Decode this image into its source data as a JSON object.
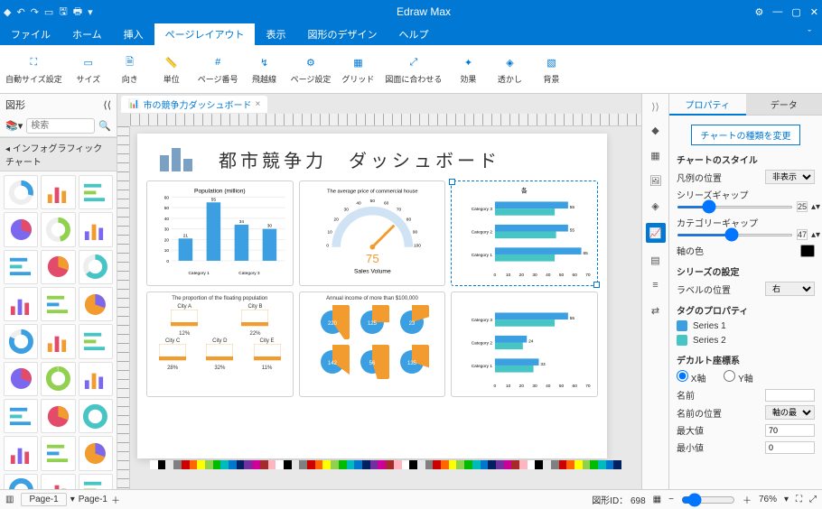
{
  "app": {
    "title": "Edraw Max"
  },
  "menu": {
    "items": [
      "ファイル",
      "ホーム",
      "挿入",
      "ページレイアウト",
      "表示",
      "図形のデザイン",
      "ヘルプ"
    ],
    "active": 3
  },
  "ribbon": [
    {
      "label": "自動サイズ設定"
    },
    {
      "label": "サイズ"
    },
    {
      "label": "向き"
    },
    {
      "label": "単位"
    },
    {
      "label": "ページ番号"
    },
    {
      "label": "飛越線"
    },
    {
      "label": "ページ設定"
    },
    {
      "label": "グリッド"
    },
    {
      "label": "図面に合わせる"
    },
    {
      "label": "効果"
    },
    {
      "label": "透かし"
    },
    {
      "label": "背景"
    }
  ],
  "leftpanel": {
    "title": "図形",
    "search_placeholder": "検索",
    "category": "インフォグラフィックチャート"
  },
  "doctab": {
    "name": "市の競争力ダッシュボード"
  },
  "dashboard": {
    "title": "都市競争力　ダッシュボード"
  },
  "rightpanel": {
    "tabs": [
      "プロパティ",
      "データ"
    ],
    "change_type": "チャートの種類を変更",
    "style_title": "チャートのスタイル",
    "legend_pos_label": "凡例の位置",
    "legend_pos_value": "非表示",
    "series_gap_label": "シリーズギャップ",
    "series_gap_value": "25",
    "category_gap_label": "カテゴリーギャップ",
    "category_gap_value": "47",
    "axis_color_label": "軸の色",
    "series_settings_title": "シリーズの設定",
    "label_pos_label": "ラベルの位置",
    "label_pos_value": "右",
    "tag_prop_title": "タグのプロパティ",
    "series1": "Series 1",
    "series2": "Series 2",
    "cartesian_title": "デカルト座標系",
    "xaxis": "X軸",
    "yaxis": "Y軸",
    "name_label": "名前",
    "name_pos_label": "名前の位置",
    "name_pos_value": "軸の最後",
    "max_label": "最大値",
    "max_value": "70",
    "min_label": "最小値",
    "min_value": "0"
  },
  "statusbar": {
    "page_label": "Page-1",
    "shape_id_label": "図形ID：",
    "shape_id": "698",
    "zoom": "76%"
  },
  "chart_data": [
    {
      "type": "bar",
      "title": "Population (million)",
      "categories": [
        "Category 1",
        "",
        "Category 3",
        ""
      ],
      "values": [
        21,
        55,
        34,
        30
      ],
      "ylim": [
        0,
        60
      ],
      "yticks": [
        0,
        10,
        20,
        30,
        40,
        50,
        60
      ],
      "color": "#3b9fe2"
    },
    {
      "type": "gauge",
      "title": "The average price of commercial house",
      "range": [
        0,
        100
      ],
      "ticks": [
        0,
        10,
        20,
        30,
        40,
        50,
        60,
        70,
        80,
        90,
        100
      ],
      "value": 75,
      "value_label": "75",
      "subtitle": "Sales Volume"
    },
    {
      "type": "bar",
      "title": "各",
      "orientation": "horizontal",
      "categories": [
        "Category 1",
        "Category 2",
        "Category 3"
      ],
      "series": [
        {
          "name": "Series 1",
          "values": [
            65,
            55,
            55
          ],
          "color": "#3b9fe2"
        },
        {
          "name": "Series 2",
          "values": [
            45,
            46,
            45
          ],
          "color": "#47c4c4"
        }
      ],
      "xlim": [
        0,
        70
      ],
      "xticks": [
        0,
        10,
        20,
        30,
        40,
        50,
        60,
        70
      ]
    },
    {
      "type": "table",
      "title": "The proportion of the floating population",
      "cells": [
        {
          "label": "City A",
          "value": "12%"
        },
        {
          "label": "City B",
          "value": "22%"
        },
        {
          "label": "City C",
          "value": "28%"
        },
        {
          "label": "City D",
          "value": "32%"
        },
        {
          "label": "City E",
          "value": "11%"
        }
      ]
    },
    {
      "type": "pie",
      "title": "Annual income of more than $100,000",
      "items": [
        {
          "label": "220",
          "a": 40,
          "b": 60
        },
        {
          "label": "125",
          "a": 25,
          "b": 75
        },
        {
          "label": "23",
          "a": 20,
          "b": 80
        },
        {
          "label": "142",
          "a": 35,
          "b": 65
        },
        {
          "label": "56",
          "a": 45,
          "b": 55
        },
        {
          "label": "135",
          "a": 30,
          "b": 70
        }
      ],
      "colors": [
        "#3b9fe2",
        "#f29b2e"
      ]
    },
    {
      "type": "bar",
      "orientation": "horizontal",
      "categories": [
        "Category 1",
        "Category 2",
        "Category 3"
      ],
      "series": [
        {
          "name": "Series 1",
          "values": [
            33,
            24,
            55
          ],
          "color": "#3b9fe2"
        },
        {
          "name": "Series 2",
          "values": [
            29,
            21,
            45
          ],
          "color": "#47c4c4"
        }
      ],
      "xlim": [
        0,
        70
      ],
      "xticks": [
        0,
        10,
        20,
        30,
        40,
        50,
        60,
        70
      ]
    }
  ],
  "colorbar": [
    "#fff",
    "#000",
    "#e6e6e6",
    "#808080",
    "#c00",
    "#f60",
    "#ff0",
    "#92d050",
    "#0b0",
    "#0bb",
    "#07c",
    "#002060",
    "#7030a0",
    "#c09",
    "#a52a2a",
    "#ffb6c1"
  ]
}
